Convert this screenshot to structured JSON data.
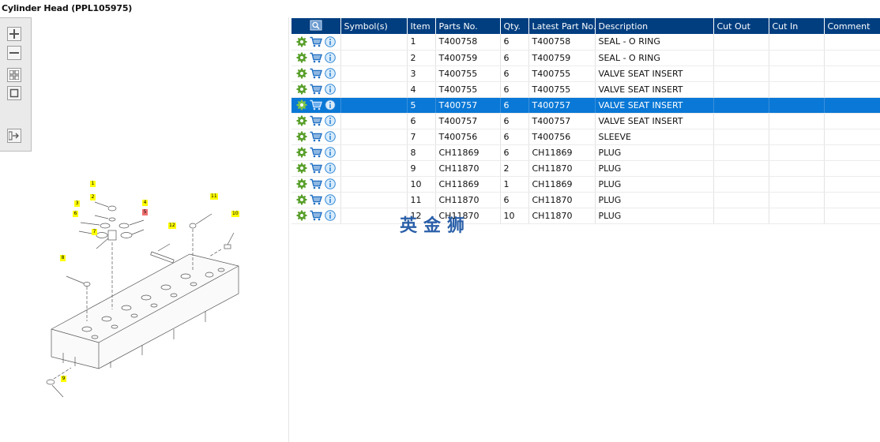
{
  "window": {
    "title": "Cylinder Head (PPL105975)"
  },
  "toolbar": {
    "buttons": [
      {
        "name": "zoom-in",
        "icon": "plus-icon"
      },
      {
        "name": "zoom-out",
        "icon": "minus-icon"
      },
      {
        "name": "fit",
        "icon": "grid-icon"
      },
      {
        "name": "window",
        "icon": "square-icon"
      },
      {
        "name": "export",
        "icon": "arrow-right-icon"
      }
    ]
  },
  "diagram": {
    "callouts": [
      "1",
      "2",
      "3",
      "4",
      "5",
      "6",
      "7",
      "8",
      "9",
      "10",
      "11",
      "12"
    ]
  },
  "table": {
    "columns": [
      "",
      "Symbol(s)",
      "Item",
      "Parts No.",
      "Qty.",
      "Latest Part No.",
      "Description",
      "Cut Out",
      "Cut In",
      "Comment"
    ],
    "rows": [
      {
        "symbol": "",
        "item": "1",
        "part": "T400758",
        "qty": "6",
        "latest": "T400758",
        "desc": "SEAL - O RING",
        "cutout": "",
        "cutin": "",
        "comment": ""
      },
      {
        "symbol": "",
        "item": "2",
        "part": "T400759",
        "qty": "6",
        "latest": "T400759",
        "desc": "SEAL - O RING",
        "cutout": "",
        "cutin": "",
        "comment": ""
      },
      {
        "symbol": "",
        "item": "3",
        "part": "T400755",
        "qty": "6",
        "latest": "T400755",
        "desc": "VALVE SEAT INSERT",
        "cutout": "",
        "cutin": "",
        "comment": ""
      },
      {
        "symbol": "",
        "item": "4",
        "part": "T400755",
        "qty": "6",
        "latest": "T400755",
        "desc": "VALVE SEAT INSERT",
        "cutout": "",
        "cutin": "",
        "comment": ""
      },
      {
        "symbol": "",
        "item": "5",
        "part": "T400757",
        "qty": "6",
        "latest": "T400757",
        "desc": "VALVE SEAT INSERT",
        "cutout": "",
        "cutin": "",
        "comment": "",
        "selected": true
      },
      {
        "symbol": "",
        "item": "6",
        "part": "T400757",
        "qty": "6",
        "latest": "T400757",
        "desc": "VALVE SEAT INSERT",
        "cutout": "",
        "cutin": "",
        "comment": ""
      },
      {
        "symbol": "",
        "item": "7",
        "part": "T400756",
        "qty": "6",
        "latest": "T400756",
        "desc": "SLEEVE",
        "cutout": "",
        "cutin": "",
        "comment": ""
      },
      {
        "symbol": "",
        "item": "8",
        "part": "CH11869",
        "qty": "6",
        "latest": "CH11869",
        "desc": "PLUG",
        "cutout": "",
        "cutin": "",
        "comment": ""
      },
      {
        "symbol": "",
        "item": "9",
        "part": "CH11870",
        "qty": "2",
        "latest": "CH11870",
        "desc": "PLUG",
        "cutout": "",
        "cutin": "",
        "comment": ""
      },
      {
        "symbol": "",
        "item": "10",
        "part": "CH11869",
        "qty": "1",
        "latest": "CH11869",
        "desc": "PLUG",
        "cutout": "",
        "cutin": "",
        "comment": ""
      },
      {
        "symbol": "",
        "item": "11",
        "part": "CH11870",
        "qty": "6",
        "latest": "CH11870",
        "desc": "PLUG",
        "cutout": "",
        "cutin": "",
        "comment": ""
      },
      {
        "symbol": "",
        "item": "12",
        "part": "CH11870",
        "qty": "10",
        "latest": "CH11870",
        "desc": "PLUG",
        "cutout": "",
        "cutin": "",
        "comment": ""
      }
    ]
  },
  "watermark": "英金狮",
  "colors": {
    "header": "#003e80",
    "selected": "#0a78d6",
    "callout": "#ffff00",
    "callout_selected": "#f07070",
    "gear": "#5aa02c",
    "cart": "#1e6fc4",
    "info": "#2e86d6"
  }
}
